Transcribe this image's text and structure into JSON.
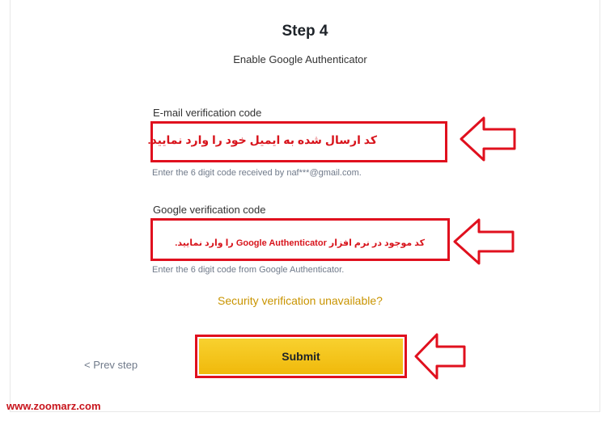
{
  "header": {
    "step_title": "Step 4",
    "subtitle": "Enable Google Authenticator"
  },
  "email_field": {
    "label": "E-mail verification code",
    "annotation": "کد ارسال شده به ایمیل خود را وارد نمایید.",
    "hint": "Enter the 6 digit code received by naf***@gmail.com."
  },
  "google_field": {
    "label": "Google verification code",
    "annotation": "کد موجود در نرم افزار Google Authenticator را وارد نمایید.",
    "hint": "Enter the 6 digit code from Google Authenticator."
  },
  "links": {
    "security_unavailable": "Security verification unavailable?",
    "prev_step": "< Prev step"
  },
  "actions": {
    "submit_label": "Submit"
  },
  "watermark": {
    "text": "www.zoomarz.com"
  },
  "colors": {
    "accent": "#f0b90b",
    "annotation_red": "#e0101e",
    "link_gold": "#c99400"
  }
}
